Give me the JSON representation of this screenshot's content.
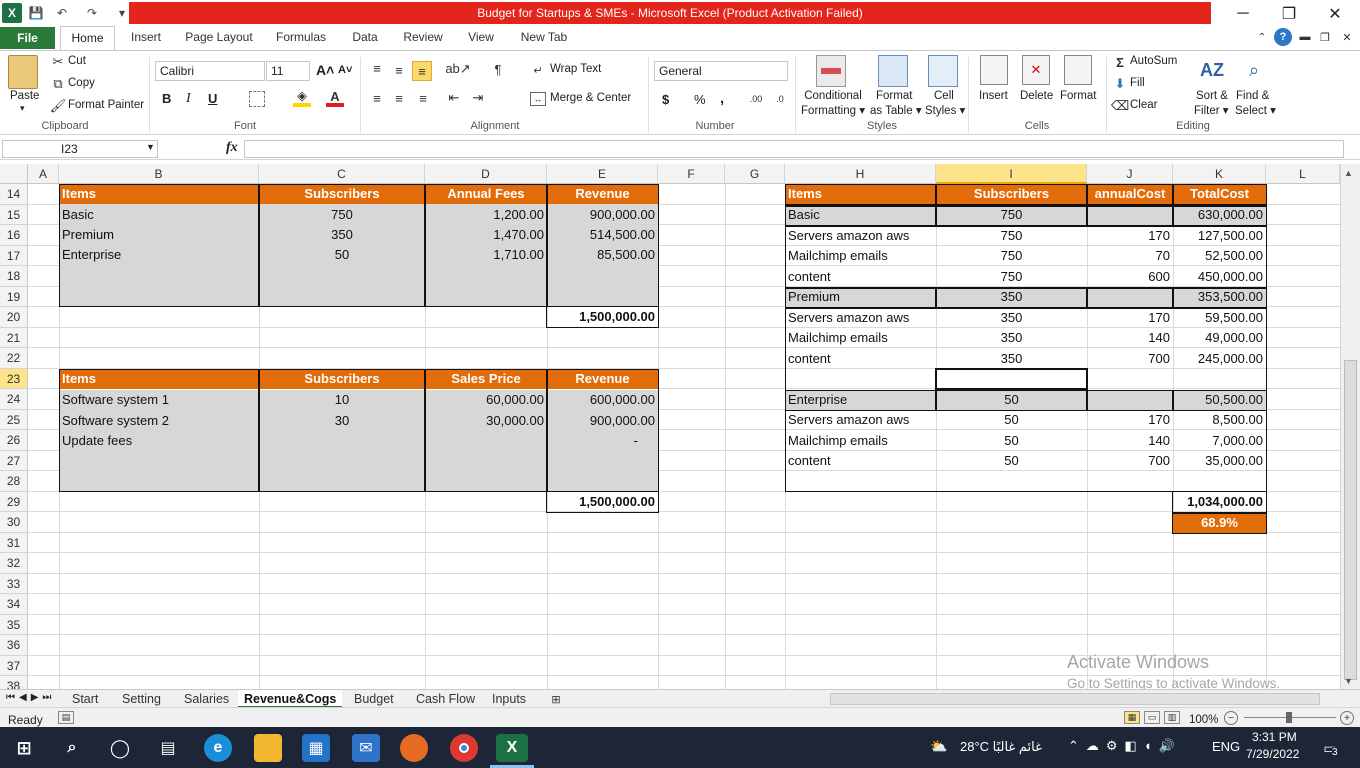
{
  "window": {
    "title": "Budget for Startups & SMEs  -  Microsoft Excel (Product Activation Failed)",
    "minimize": "─",
    "restore": "❐",
    "close": "✕",
    "title_color": "#e3251b"
  },
  "quick_access": {
    "app": "X",
    "save": "💾",
    "undo": "↶",
    "redo": "↷",
    "customize": "▾"
  },
  "ribbon_tabs": {
    "file": "File",
    "items": [
      "Home",
      "Insert",
      "Page Layout",
      "Formulas",
      "Data",
      "Review",
      "View",
      "New Tab"
    ]
  },
  "clipboard": {
    "paste": "Paste",
    "cut": "Cut",
    "copy": "Copy",
    "format_painter": "Format Painter",
    "group": "Clipboard"
  },
  "font": {
    "name": "Calibri",
    "size": "11",
    "group": "Font",
    "bold": "B",
    "italic": "I",
    "underline": "U",
    "grow": "A˄",
    "shrink": "A˅"
  },
  "alignment": {
    "wrap_text": "Wrap Text",
    "merge_center": "Merge & Center",
    "group": "Alignment"
  },
  "number": {
    "format": "General",
    "group": "Number",
    "currency": "$",
    "percent": "%",
    "comma": ","
  },
  "styles": {
    "conditional": [
      "Conditional",
      "Formatting ▾"
    ],
    "format_table": [
      "Format",
      "as Table ▾"
    ],
    "cell_styles": [
      "Cell",
      "Styles ▾"
    ],
    "group": "Styles"
  },
  "cells": {
    "insert": "Insert",
    "delete": "Delete",
    "format": "Format",
    "group": "Cells"
  },
  "editing": {
    "autosum": "AutoSum",
    "fill": "Fill",
    "clear": "Clear",
    "sort_filter": [
      "Sort &",
      "Filter ▾"
    ],
    "find_select": [
      "Find &",
      "Select ▾"
    ],
    "group": "Editing"
  },
  "formula_bar": {
    "name_box": "I23",
    "fx": "fx",
    "value": ""
  },
  "columns": [
    "A",
    "B",
    "C",
    "D",
    "E",
    "F",
    "G",
    "H",
    "I",
    "J",
    "K",
    "L"
  ],
  "selected_column": "I",
  "rows": [
    "14",
    "15",
    "16",
    "17",
    "18",
    "19",
    "20",
    "21",
    "22",
    "23",
    "24",
    "25",
    "26",
    "27",
    "28",
    "29",
    "30",
    "31",
    "32",
    "33",
    "34",
    "35",
    "36",
    "37",
    "38"
  ],
  "selected_row": "23",
  "table1": {
    "headers": [
      "Items",
      "Subscribers",
      "Annual Fees",
      "Revenue"
    ],
    "rows": [
      [
        "Basic",
        "750",
        "1,200.00",
        "900,000.00"
      ],
      [
        "Premium",
        "350",
        "1,470.00",
        "514,500.00"
      ],
      [
        "Enterprise",
        "50",
        "1,710.00",
        "85,500.00"
      ]
    ],
    "total": "1,500,000.00"
  },
  "table2": {
    "headers": [
      "Items",
      "Subscribers",
      "Sales Price",
      "Revenue"
    ],
    "rows": [
      [
        "Software system 1",
        "10",
        "60,000.00",
        "600,000.00"
      ],
      [
        "Software system 2",
        "30",
        "30,000.00",
        "900,000.00"
      ],
      [
        "Update fees",
        "",
        "",
        "-"
      ]
    ],
    "total": "1,500,000.00"
  },
  "table3": {
    "headers": [
      "Items",
      "Subscribers",
      "annualCost",
      "TotalCost"
    ],
    "rows": [
      [
        "Basic",
        "750",
        "",
        "630,000.00"
      ],
      [
        "Servers amazon aws",
        "750",
        "170",
        "127,500.00"
      ],
      [
        "Mailchimp emails",
        "750",
        "70",
        "52,500.00"
      ],
      [
        "content",
        "750",
        "600",
        "450,000.00"
      ],
      [
        "Premium",
        "350",
        "",
        "353,500.00"
      ],
      [
        "Servers amazon aws",
        "350",
        "170",
        "59,500.00"
      ],
      [
        "Mailchimp emails",
        "350",
        "140",
        "49,000.00"
      ],
      [
        "content",
        "350",
        "700",
        "245,000.00"
      ],
      [
        "",
        "",
        "",
        ""
      ],
      [
        "Enterprise",
        "50",
        "",
        "50,500.00"
      ],
      [
        "Servers amazon aws",
        "50",
        "170",
        "8,500.00"
      ],
      [
        "Mailchimp emails",
        "50",
        "140",
        "7,000.00"
      ],
      [
        "content",
        "50",
        "700",
        "35,000.00"
      ]
    ],
    "total": "1,034,000.00",
    "ratio": "68.9%"
  },
  "sheet_tabs": [
    "Start",
    "Setting",
    "Salaries",
    "Revenue&Cogs",
    "Budget",
    "Cash Flow",
    "Inputs"
  ],
  "active_sheet": "Revenue&Cogs",
  "status": {
    "ready": "Ready",
    "zoom": "100%"
  },
  "watermark": {
    "line1": "Activate Windows",
    "line2": "Go to Settings to activate Windows."
  },
  "taskbar": {
    "weather": "28°C  غائم غالبًا",
    "lang": "ENG",
    "time": "3:31 PM",
    "date": "7/29/2022",
    "notifications": "3"
  },
  "colors": {
    "header_orange": "#e36c0a",
    "shade_gray": "#d7d7d7",
    "excel_green": "#2b7a3a"
  }
}
